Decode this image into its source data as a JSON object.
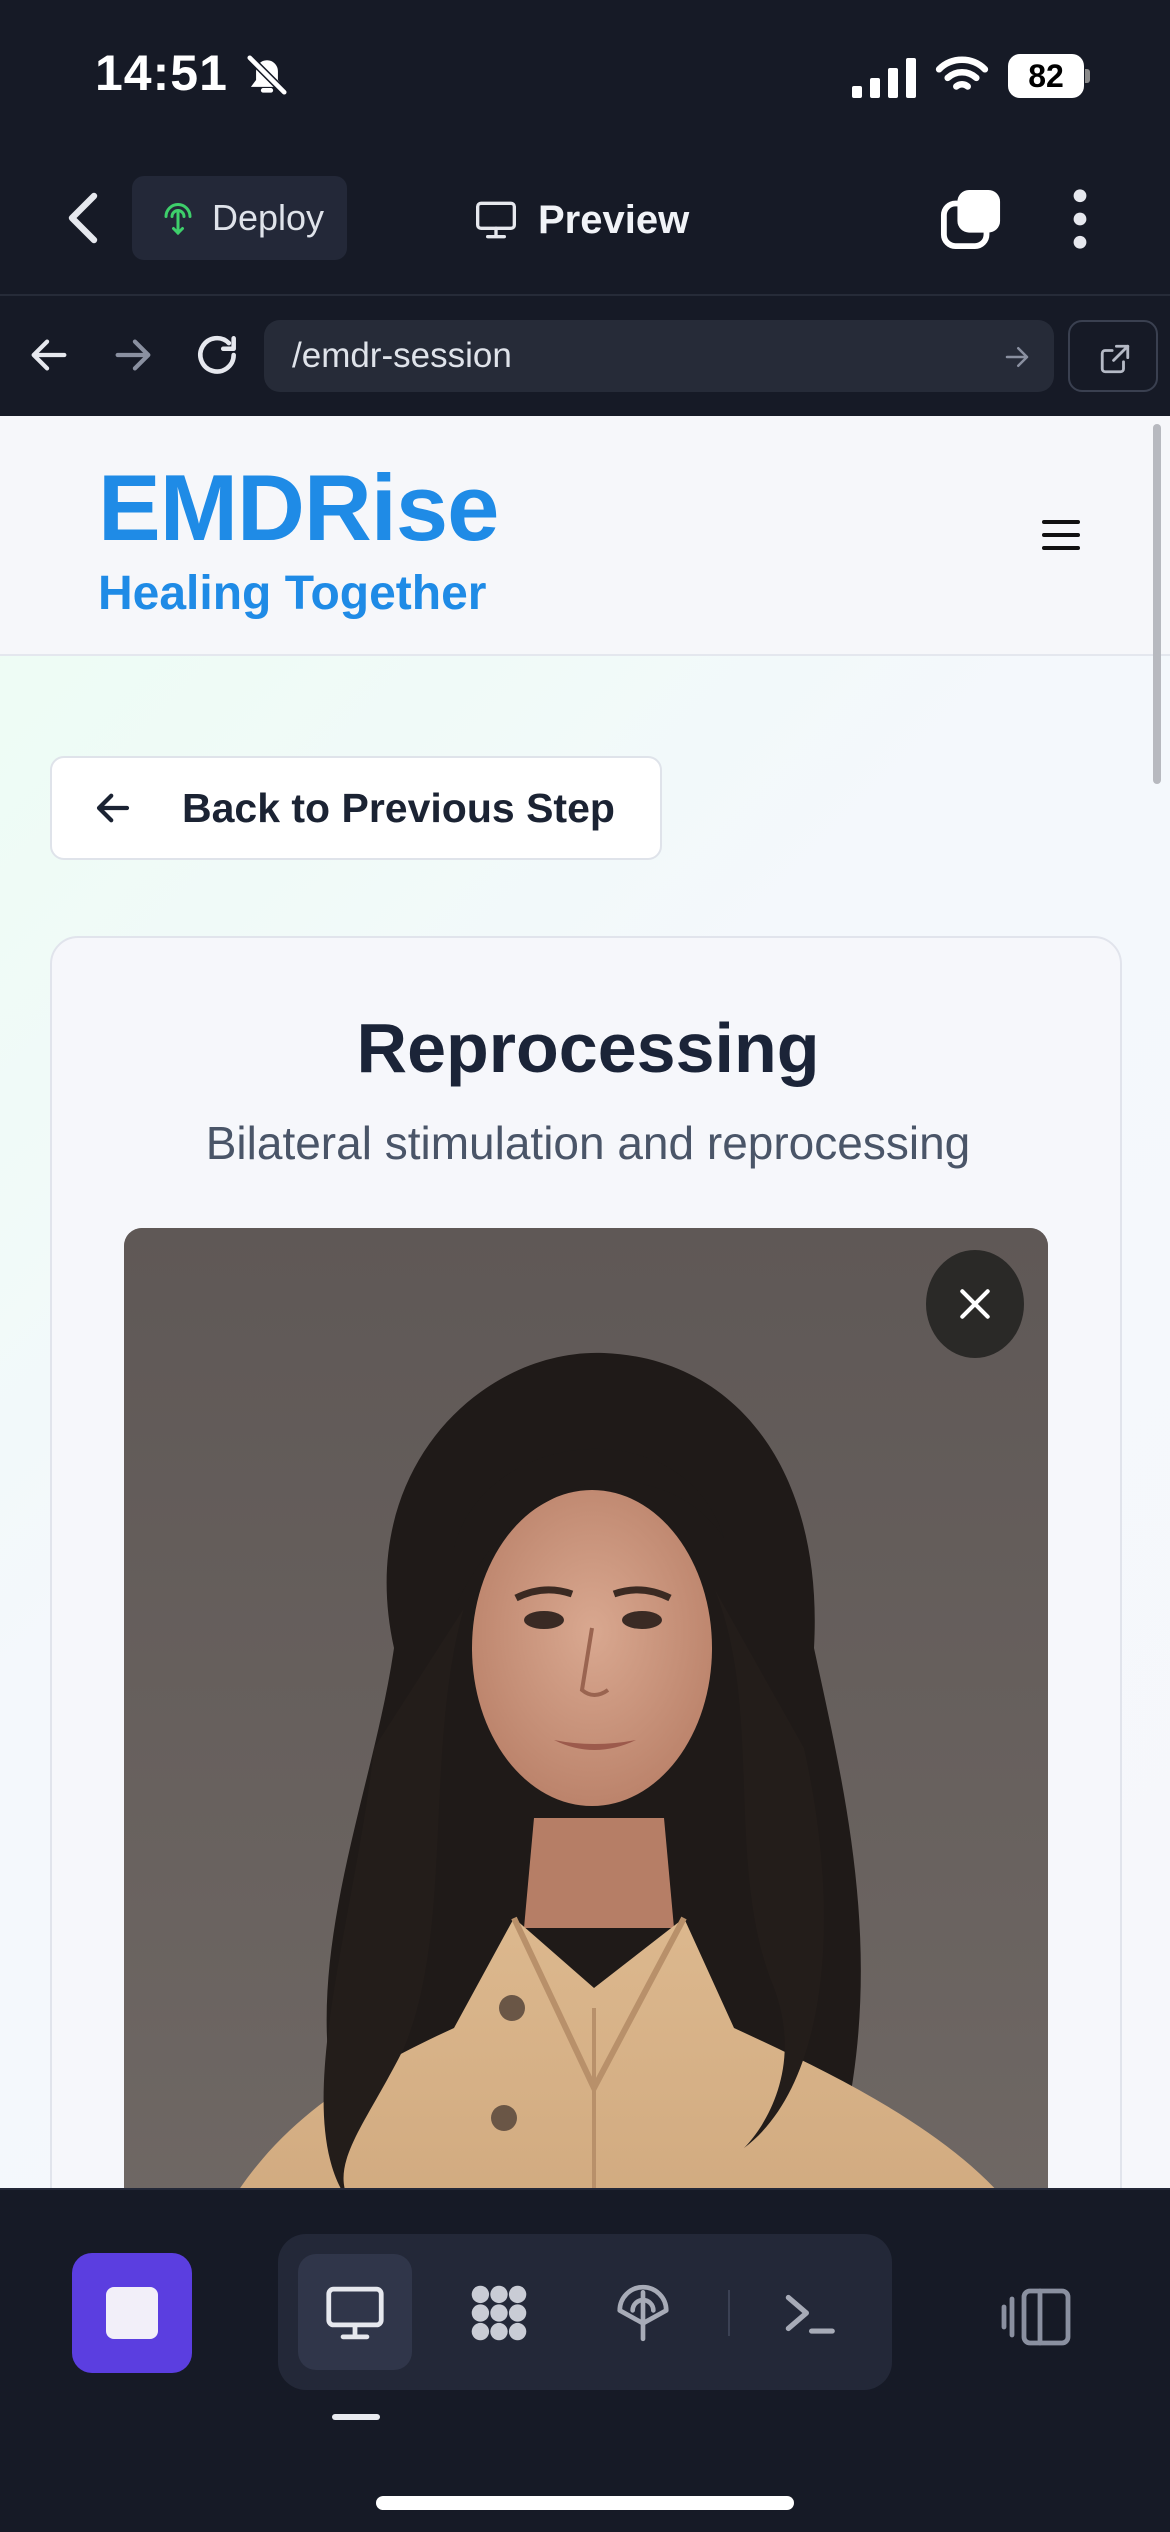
{
  "status_bar": {
    "time": "14:51",
    "battery": "82",
    "icons": [
      "bell-muted-icon",
      "signal-icon",
      "wifi-icon",
      "battery-icon"
    ]
  },
  "app_toolbar": {
    "deploy_label": "Deploy",
    "preview_label": "Preview",
    "icons": [
      "back-chevron-icon",
      "deploy-icon",
      "monitor-icon",
      "tabs-icon",
      "more-vertical-icon"
    ]
  },
  "browser": {
    "url": "/emdr-session",
    "icons": [
      "arrow-left-icon",
      "arrow-right-icon",
      "reload-icon",
      "go-arrow-icon",
      "open-external-icon"
    ]
  },
  "site": {
    "brand": "EMDRise",
    "tagline": "Healing Together",
    "back_button": "Back to Previous Step",
    "card": {
      "title": "Reprocessing",
      "subtitle": "Bilateral stimulation and reprocessing"
    },
    "video": {
      "content": "therapist video feed",
      "icons": [
        "close-icon"
      ]
    }
  },
  "bottom_bar": {
    "active_tool": "preview",
    "tools": [
      "preview",
      "modules",
      "deploy",
      "terminal"
    ],
    "icons": [
      "stop-icon",
      "monitor-icon",
      "grid-dots-icon",
      "deploy-icon",
      "terminal-icon",
      "panel-toggle-icon"
    ]
  },
  "colors": {
    "brand_blue": "#1f8be6",
    "stop_purple": "#5b3ee0",
    "chrome_dark": "#161a26",
    "deploy_green": "#3ecf6b"
  }
}
